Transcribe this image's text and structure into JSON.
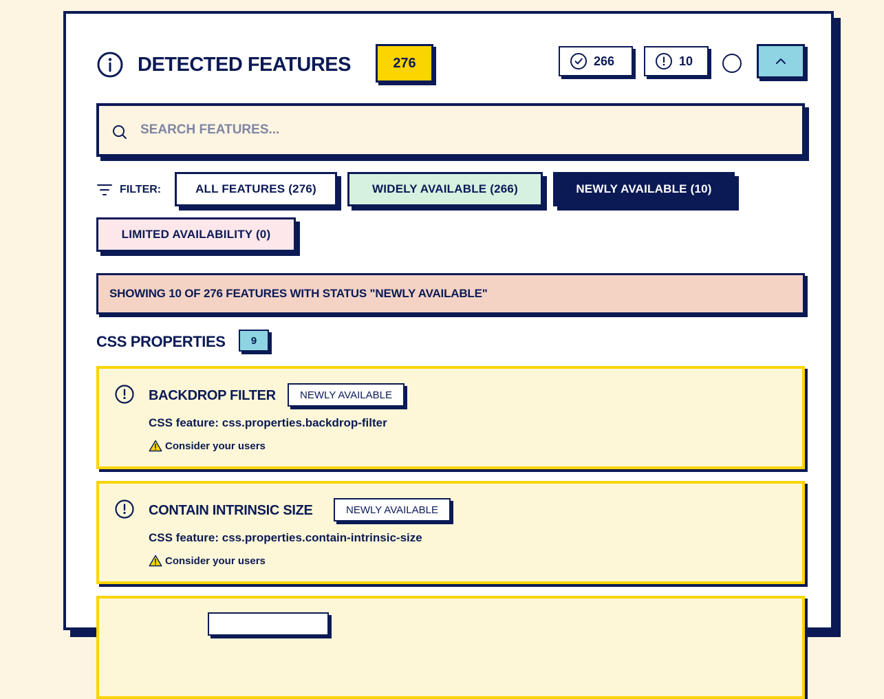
{
  "header": {
    "title": "DETECTED FEATURES",
    "total_count": "276",
    "widely_count": "266",
    "newly_count": "10"
  },
  "search": {
    "placeholder": "SEARCH FEATURES..."
  },
  "filter": {
    "label": "FILTER:",
    "chips": [
      {
        "label": "ALL FEATURES (276)"
      },
      {
        "label": "WIDELY AVAILABLE (266)"
      },
      {
        "label": "NEWLY AVAILABLE (10)",
        "active": true
      },
      {
        "label": "LIMITED AVAILABILITY (0)"
      }
    ]
  },
  "notice": {
    "text": "SHOWING 10 OF 276 FEATURES WITH STATUS \"NEWLY AVAILABLE\""
  },
  "section": {
    "title": "CSS PROPERTIES",
    "count": "9"
  },
  "features": [
    {
      "name": "BACKDROP FILTER",
      "badge": "NEWLY AVAILABLE",
      "description": "CSS feature: css.properties.backdrop-filter",
      "warning": "Consider your users"
    },
    {
      "name": "CONTAIN INTRINSIC SIZE",
      "badge": "NEWLY AVAILABLE",
      "description": "CSS feature: css.properties.contain-intrinsic-size",
      "warning": "Consider your users"
    }
  ],
  "colors": {
    "navy": "#0b1a55",
    "yellow": "#fcd400",
    "cyan": "#8ed4e2",
    "cream": "#fdf5e2",
    "mint": "#d7f1e0",
    "pink": "#fde7ea",
    "peach": "#f4d3c5"
  }
}
